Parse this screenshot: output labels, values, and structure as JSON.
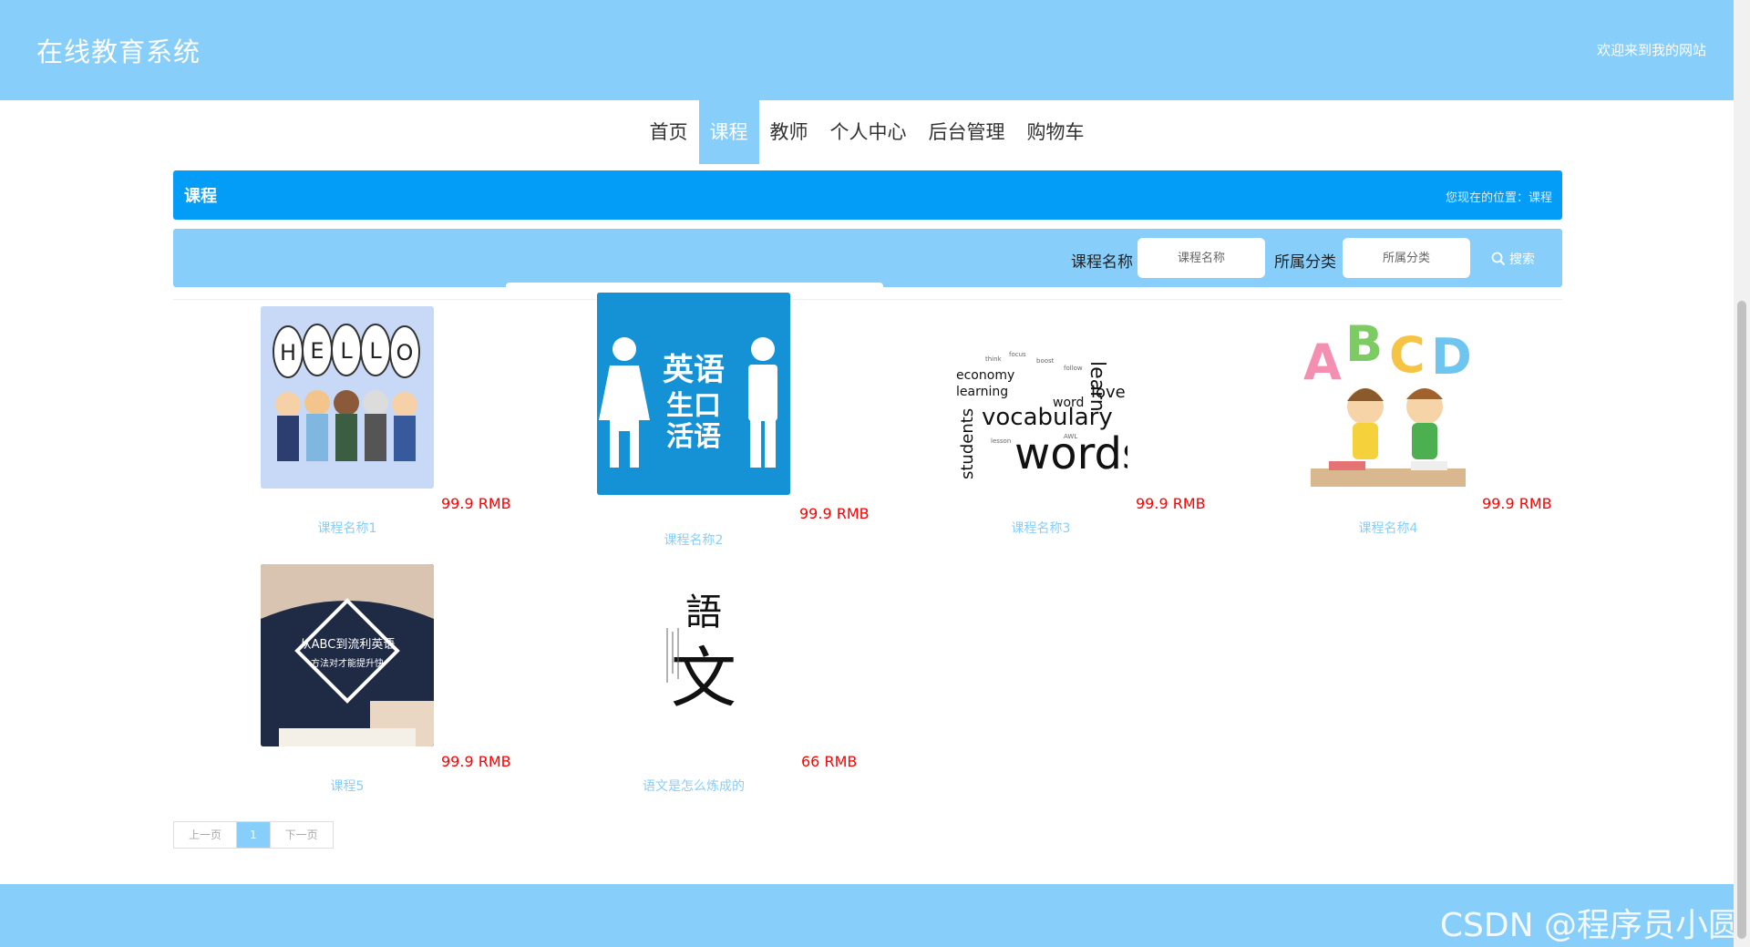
{
  "header": {
    "site_title": "在线教育系统",
    "welcome": "欢迎来到我的网站"
  },
  "nav": {
    "items": [
      "首页",
      "课程",
      "教师",
      "个人中心",
      "后台管理",
      "购物车"
    ],
    "active": "课程"
  },
  "breadcrumb": {
    "title": "课程",
    "position": "您现在的位置：课程"
  },
  "search": {
    "name_label": "课程名称",
    "name_placeholder": "课程名称",
    "category_label": "所属分类",
    "category_placeholder": "所属分类",
    "button_label": "搜索"
  },
  "courses": [
    {
      "name": "课程名称1",
      "price": "99.9 RMB",
      "image": "hello-cartoon-kids"
    },
    {
      "name": "课程名称2",
      "price": "99.9 RMB",
      "image": "english-oral-sign"
    },
    {
      "name": "课程名称3",
      "price": "99.9 RMB",
      "image": "vocabulary-words-cloud",
      "image_text": [
        "vocabulary",
        "words",
        "learning",
        "economy",
        "students",
        "love",
        "learn",
        "word"
      ]
    },
    {
      "name": "课程名称4",
      "price": "99.9 RMB",
      "image": "abcd-kids-reading",
      "image_text": [
        "A",
        "B",
        "C",
        "D"
      ]
    },
    {
      "name": "课程5",
      "price": "99.9 RMB",
      "image": "english-study-photo",
      "image_text": [
        "从ABC到流利英语",
        "方法对才能提升快"
      ]
    },
    {
      "name": "语文是怎么炼成的",
      "price": "66 RMB",
      "image": "chinese-calligraphy",
      "image_text": [
        "語",
        "文"
      ]
    }
  ],
  "pagination": {
    "prev": "上一页",
    "current": "1",
    "next": "下一页"
  },
  "watermark": "CSDN @程序员小圆",
  "colors": {
    "header": "#87cefa",
    "breadcrumb": "#039cf7",
    "price": "#ff0000",
    "link": "#87cefa"
  }
}
